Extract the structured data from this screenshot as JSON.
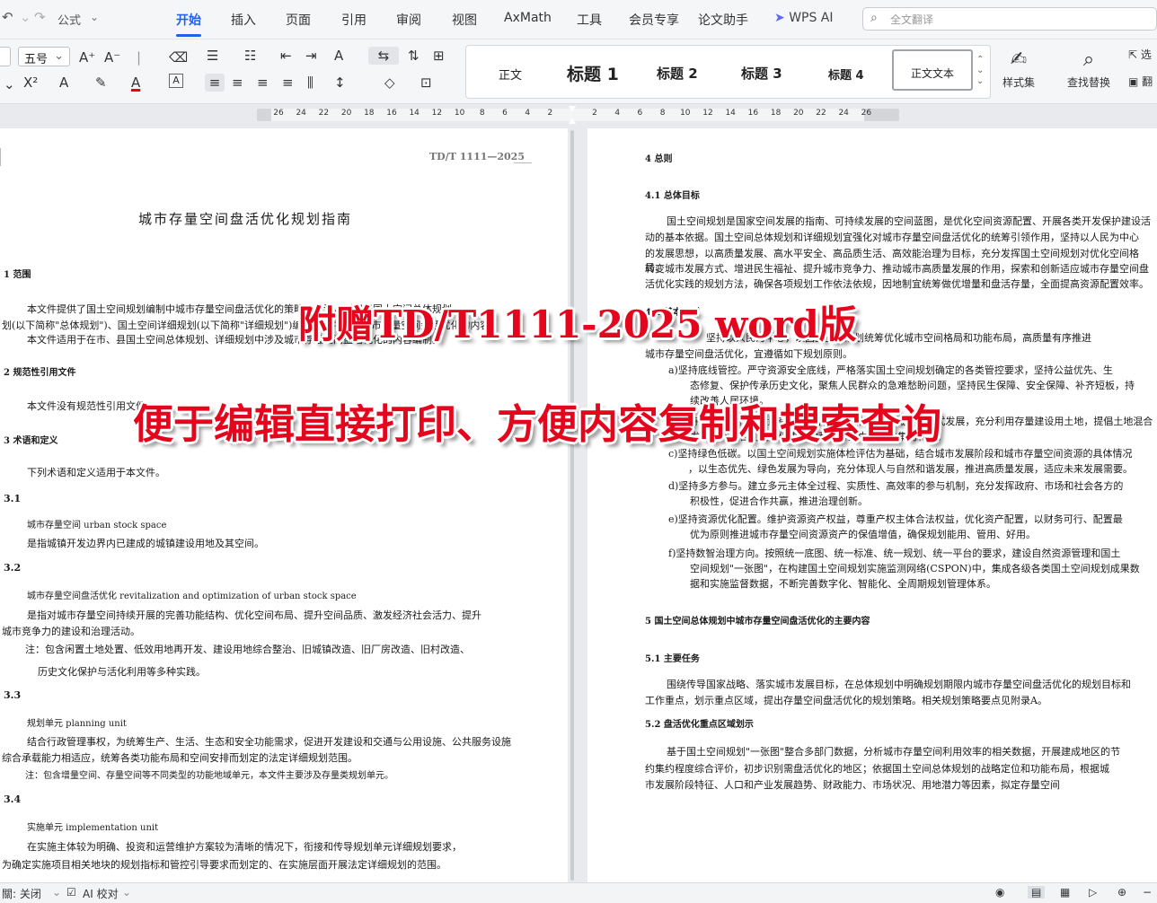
{
  "menubar": {
    "font_select": "公式",
    "tabs": [
      "开始",
      "插入",
      "页面",
      "引用",
      "审阅",
      "视图",
      "AxMath",
      "工具",
      "会员专享",
      "论文助手",
      "WPS AI"
    ],
    "search_placeholder": "全文翻译"
  },
  "ribbon": {
    "font_size": "五号",
    "styles": [
      "正文",
      "标题 1",
      "标题 2",
      "标题 3",
      "标题 4",
      "正文文本"
    ],
    "style_set_label": "样式集",
    "find_replace_label": "查找替换",
    "select_label": "选",
    "translate_label": "翻"
  },
  "ruler": {
    "left_ticks": [
      "26",
      "24",
      "22",
      "20",
      "18",
      "16",
      "14",
      "12",
      "10",
      "8",
      "6",
      "4",
      "2"
    ],
    "right_ticks": [
      "2",
      "4",
      "6",
      "8",
      "10",
      "12",
      "14",
      "16",
      "18",
      "20",
      "22",
      "24",
      "26"
    ]
  },
  "left_page": {
    "header_code": "TD/T 1111—2025",
    "title": "城市存量空间盘活优化规划指南",
    "sec1_heading": "1  范围",
    "sec1_p1": "本文件提供了国土空间规划编制中城市存量空间盘活优化的策略与方法，适用于国土空间总体规划",
    "sec1_p2": "划(以下简称\"总体规划\")、国土空间详细规划(以下简称\"详细规划\")编制工作中涉及城市存量空间盘活优化的内容",
    "sec1_p3": "本文件适用于在市、县国土空间总体规划、详细规划中涉及城市存量空间盘活优化的内容编制。",
    "sec2_heading": "2  规范性引用文件",
    "sec2_p1": "本文件没有规范性引用文件。",
    "sec3_heading": "3  术语和定义",
    "sec3_p1": "下列术语和定义适用于本文件。",
    "t31_num": "3.1",
    "t31_term": "城市存量空间  urban stock space",
    "t31_def": "是指城镇开发边界内已建成的城镇建设用地及其空间。",
    "t32_num": "3.2",
    "t32_term": "城市存量空间盘活优化  revitalization and optimization of urban stock space",
    "t32_def1": "是指对城市存量空间持续开展的完善功能结构、优化空间布局、提升空间品质、激发经济社会活力、提升",
    "t32_def2": "城市竞争力的建设和治理活动。",
    "t32_note1": "注：包含闲置土地处置、低效用地再开发、建设用地综合整治、旧城镇改造、旧厂房改造、旧村改造、",
    "t32_note2": "历史文化保护与活化利用等多种实践。",
    "t33_num": "3.3",
    "t33_term": "规划单元  planning unit",
    "t33_def1": "结合行政管理事权，为统筹生产、生活、生态和安全功能需求，促进开发建设和交通与公用设施、公共服务设施",
    "t33_def2": "综合承载能力相适应，统筹各类功能布局和空间安排而划定的法定详细规划范围。",
    "t33_note": "注：包含增量空间、存量空间等不同类型的功能地域单元，本文件主要涉及存量类规划单元。",
    "t34_num": "3.4",
    "t34_term": "实施单元  implementation unit",
    "t34_def1": "在实施主体较为明确、投资和运营维护方案较为清晰的情况下，衔接和传导规划单元详细规划要求，",
    "t34_def2": "为确定实施项目相关地块的规划指标和管控引导要求而划定的、在实施层面开展法定详细规划的范围。"
  },
  "right_page": {
    "sec4_heading": "4  总则",
    "s41_heading": "4.1  总体目标",
    "s41_p1": "国土空间规划是国家空间发展的指南、可持续发展的空间蓝图，是优化空间资源配置、开展各类开发保护建设活",
    "s41_p2": "动的基本依据。国土空间总体规划和详细规划宜强化对城市存量空间盘活优化的统筹引领作用，坚持以人民为中心",
    "s41_p3": "的发展思想，以高质量发展、高水平安全、高品质生活、高效能治理为目标，充分发挥国土空间规划对优化空间格局、",
    "s41_p4": "转变城市发展方式、增进民生福祉、提升城市竞争力、推动城市高质量发展的作用，探索和创新适应城市存量空间盘",
    "s41_p5": "活优化实践的规划方法，确保各项规划工作依法依规，因地制宜统筹做优增量和盘活存量，全面提高资源配置效率。",
    "s42_heading": "4.2  基本原则",
    "s42_p1": "坚持以人民为中心，以国土空间规划统筹优化城市空间格局和功能布局，高质量有序推进",
    "s42_p2": "城市存量空间盘活优化，宜遵循如下规划原则。",
    "item_a1": "a)坚持底线管控。严守资源安全底线，严格落实国土空间规划确定的各类管控要求，坚持公益优先、生",
    "item_a2": "态修复、保护传承历史文化，聚焦人民群众的急难愁盼问题，坚持民生保障、安全保障、补齐短板，持",
    "item_a3": "续改善人居环境。",
    "item_b1": "b)坚持节约集约。以存量空间盘活利用为重点，引导城市内涵式发展，充分利用存量建设用土地，提倡土地混合开",
    "item_b2": "发和空间复合利用，促进土地利用方式由粗放向集约转变。",
    "item_c1": "c)坚持绿色低碳。以国土空间规划实施体检评估为基础，结合城市发展阶段和城市存量空间资源的具体情况",
    "item_c2": "，以生态优先、绿色发展为导向，充分体现人与自然和谐发展，推进高质量发展，适应未来发展需要。",
    "item_d1": "d)坚持多方参与。建立多元主体全过程、实质性、高效率的参与机制，充分发挥政府、市场和社会各方的",
    "item_d2": "积极性，促进合作共赢，推进治理创新。",
    "item_e1": "e)坚持资源优化配置。维护资源资产权益，尊重产权主体合法权益，优化资产配置，以财务可行、配置最",
    "item_e2": "优为原则推进城市存量空间资源资产的保值增值，确保规划能用、管用、好用。",
    "item_f1": "f)坚持数智治理方向。按照统一底图、统一标准、统一规划、统一平台的要求，建设自然资源管理和国土",
    "item_f2": "空间规划\"一张图\"，在构建国土空间规划实施监测网络(CSPON)中，集成各级各类国土空间规划成果数",
    "item_f3": "据和实施监督数据，不断完善数字化、智能化、全周期规划管理体系。",
    "sec5_heading": "5  国土空间总体规划中城市存量空间盘活优化的主要内容",
    "s51_heading": "5.1  主要任务",
    "s51_p1": "围绕传导国家战略、落实城市发展目标，在总体规划中明确规划期限内城市存量空间盘活优化的规划目标和",
    "s51_p2": "工作重点，划示重点区域，提出存量空间盘活优化的规划策略。相关规划策略要点见附录A。",
    "s52_heading": "5.2  盘活优化重点区域划示",
    "s52_p1": "基于国土空间规划\"一张图\"整合多部门数据，分析城市存量空间利用效率的相关数据，开展建成地区的节",
    "s52_p2": "约集约程度综合评价，初步识别需盘活优化的地区；依据国土空间总体规划的战略定位和功能布局，根据城",
    "s52_p3": "市发展阶段特征、人口和产业发展趋势、财政能力、市场状况、用地潜力等因素，拟定存量空间"
  },
  "overlay": {
    "line1": "附赠TD/T1111-2025 word版",
    "line2": "便于编辑直接打印、方便内容复制和搜索查询"
  },
  "statusbar": {
    "left_label": "關: 关闭",
    "ai_check": "AI 校对"
  }
}
